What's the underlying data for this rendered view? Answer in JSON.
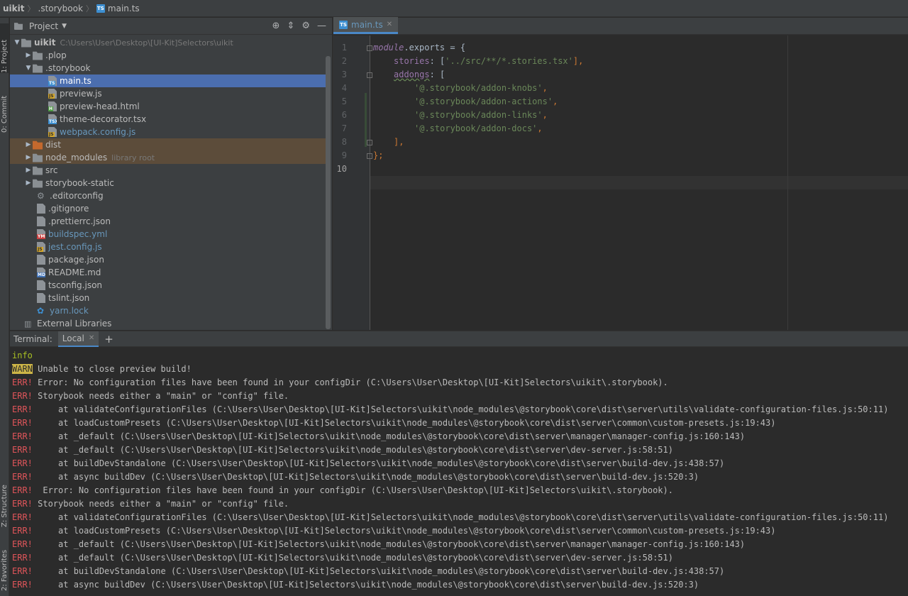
{
  "navbar": {
    "crumbs": [
      "uikit",
      ".storybook",
      "main.ts"
    ]
  },
  "toolwindows": {
    "project": "1: Project",
    "commit": "0: Commit",
    "structure": "Z: Structure",
    "favorites": "2: Favorites"
  },
  "project": {
    "title": "Project",
    "tools": [
      "locate-icon",
      "collapse-icon",
      "gear-icon",
      "minimize-icon"
    ],
    "root_name": "uikit",
    "root_path": "C:\\Users\\User\\Desktop\\[UI-Kit]Selectors\\uikit",
    "items": [
      {
        "label": ".plop"
      },
      {
        "label": ".storybook"
      },
      {
        "label": "main.ts",
        "badge": "TS"
      },
      {
        "label": "preview.js",
        "badge": "JS"
      },
      {
        "label": "preview-head.html",
        "badge": "H"
      },
      {
        "label": "theme-decorator.tsx",
        "badge": "TSX"
      },
      {
        "label": "webpack.config.js",
        "badge": "JS"
      },
      {
        "label": "dist"
      },
      {
        "label": "node_modules",
        "hint": "library root"
      },
      {
        "label": "src"
      },
      {
        "label": "storybook-static"
      },
      {
        "label": ".editorconfig"
      },
      {
        "label": ".gitignore"
      },
      {
        "label": ".prettierrc.json"
      },
      {
        "label": "buildspec.yml",
        "badge": "YML"
      },
      {
        "label": "jest.config.js",
        "badge": "JS"
      },
      {
        "label": "package.json"
      },
      {
        "label": "README.md",
        "badge": "MD"
      },
      {
        "label": "tsconfig.json"
      },
      {
        "label": "tslint.json"
      },
      {
        "label": "yarn.lock"
      },
      {
        "label": "External Libraries"
      }
    ]
  },
  "editor": {
    "tab_label": "main.ts",
    "line_numbers": [
      "1",
      "2",
      "3",
      "4",
      "5",
      "6",
      "7",
      "8",
      "9",
      "10"
    ],
    "code": {
      "l1_a": "module",
      "l1_b": ".exports = {",
      "l2_key": "stories",
      "l2_mid": ": [",
      "l2_str": "'../src/**/*.stories.tsx'",
      "l2_end": "],",
      "l3_key": "addongs",
      "l3_end": ": [",
      "l4": "'@.storybook/addon-knobs'",
      "l5": "'@.storybook/addon-actions'",
      "l6": "'@.storybook/addon-links'",
      "l7": "'@.storybook/addon-docs'",
      "comma": ",",
      "l8": "],",
      "l9": "};"
    }
  },
  "terminal": {
    "title": "Terminal:",
    "tab_label": "Local",
    "lines": [
      {
        "level": "info",
        "text": ""
      },
      {
        "level": "WARN",
        "text": " Unable to close preview build!"
      },
      {
        "level": "ERR!",
        "text": " Error: No configuration files have been found in your configDir (C:\\Users\\User\\Desktop\\[UI-Kit]Selectors\\uikit\\.storybook)."
      },
      {
        "level": "ERR!",
        "text": " Storybook needs either a \"main\" or \"config\" file."
      },
      {
        "level": "ERR!",
        "text": "     at validateConfigurationFiles (C:\\Users\\User\\Desktop\\[UI-Kit]Selectors\\uikit\\node_modules\\@storybook\\core\\dist\\server\\utils\\validate-configuration-files.js:50:11)"
      },
      {
        "level": "ERR!",
        "text": "     at loadCustomPresets (C:\\Users\\User\\Desktop\\[UI-Kit]Selectors\\uikit\\node_modules\\@storybook\\core\\dist\\server\\common\\custom-presets.js:19:43)"
      },
      {
        "level": "ERR!",
        "text": "     at _default (C:\\Users\\User\\Desktop\\[UI-Kit]Selectors\\uikit\\node_modules\\@storybook\\core\\dist\\server\\manager\\manager-config.js:160:143)"
      },
      {
        "level": "ERR!",
        "text": "     at _default (C:\\Users\\User\\Desktop\\[UI-Kit]Selectors\\uikit\\node_modules\\@storybook\\core\\dist\\server\\dev-server.js:58:51)"
      },
      {
        "level": "ERR!",
        "text": "     at buildDevStandalone (C:\\Users\\User\\Desktop\\[UI-Kit]Selectors\\uikit\\node_modules\\@storybook\\core\\dist\\server\\build-dev.js:438:57)"
      },
      {
        "level": "ERR!",
        "text": "     at async buildDev (C:\\Users\\User\\Desktop\\[UI-Kit]Selectors\\uikit\\node_modules\\@storybook\\core\\dist\\server\\build-dev.js:520:3)"
      },
      {
        "level": "ERR!",
        "text": "  Error: No configuration files have been found in your configDir (C:\\Users\\User\\Desktop\\[UI-Kit]Selectors\\uikit\\.storybook)."
      },
      {
        "level": "ERR!",
        "text": " Storybook needs either a \"main\" or \"config\" file."
      },
      {
        "level": "ERR!",
        "text": "     at validateConfigurationFiles (C:\\Users\\User\\Desktop\\[UI-Kit]Selectors\\uikit\\node_modules\\@storybook\\core\\dist\\server\\utils\\validate-configuration-files.js:50:11)"
      },
      {
        "level": "ERR!",
        "text": "     at loadCustomPresets (C:\\Users\\User\\Desktop\\[UI-Kit]Selectors\\uikit\\node_modules\\@storybook\\core\\dist\\server\\common\\custom-presets.js:19:43)"
      },
      {
        "level": "ERR!",
        "text": "     at _default (C:\\Users\\User\\Desktop\\[UI-Kit]Selectors\\uikit\\node_modules\\@storybook\\core\\dist\\server\\manager\\manager-config.js:160:143)"
      },
      {
        "level": "ERR!",
        "text": "     at _default (C:\\Users\\User\\Desktop\\[UI-Kit]Selectors\\uikit\\node_modules\\@storybook\\core\\dist\\server\\dev-server.js:58:51)"
      },
      {
        "level": "ERR!",
        "text": "     at buildDevStandalone (C:\\Users\\User\\Desktop\\[UI-Kit]Selectors\\uikit\\node_modules\\@storybook\\core\\dist\\server\\build-dev.js:438:57)"
      },
      {
        "level": "ERR!",
        "text": "     at async buildDev (C:\\Users\\User\\Desktop\\[UI-Kit]Selectors\\uikit\\node_modules\\@storybook\\core\\dist\\server\\build-dev.js:520:3)"
      }
    ]
  },
  "colors": {
    "selection": "#4b6eaf",
    "error": "#e0555a",
    "warn": "#cdb547",
    "info": "#a8c023",
    "string": "#6a8759",
    "property": "#9876aa"
  }
}
